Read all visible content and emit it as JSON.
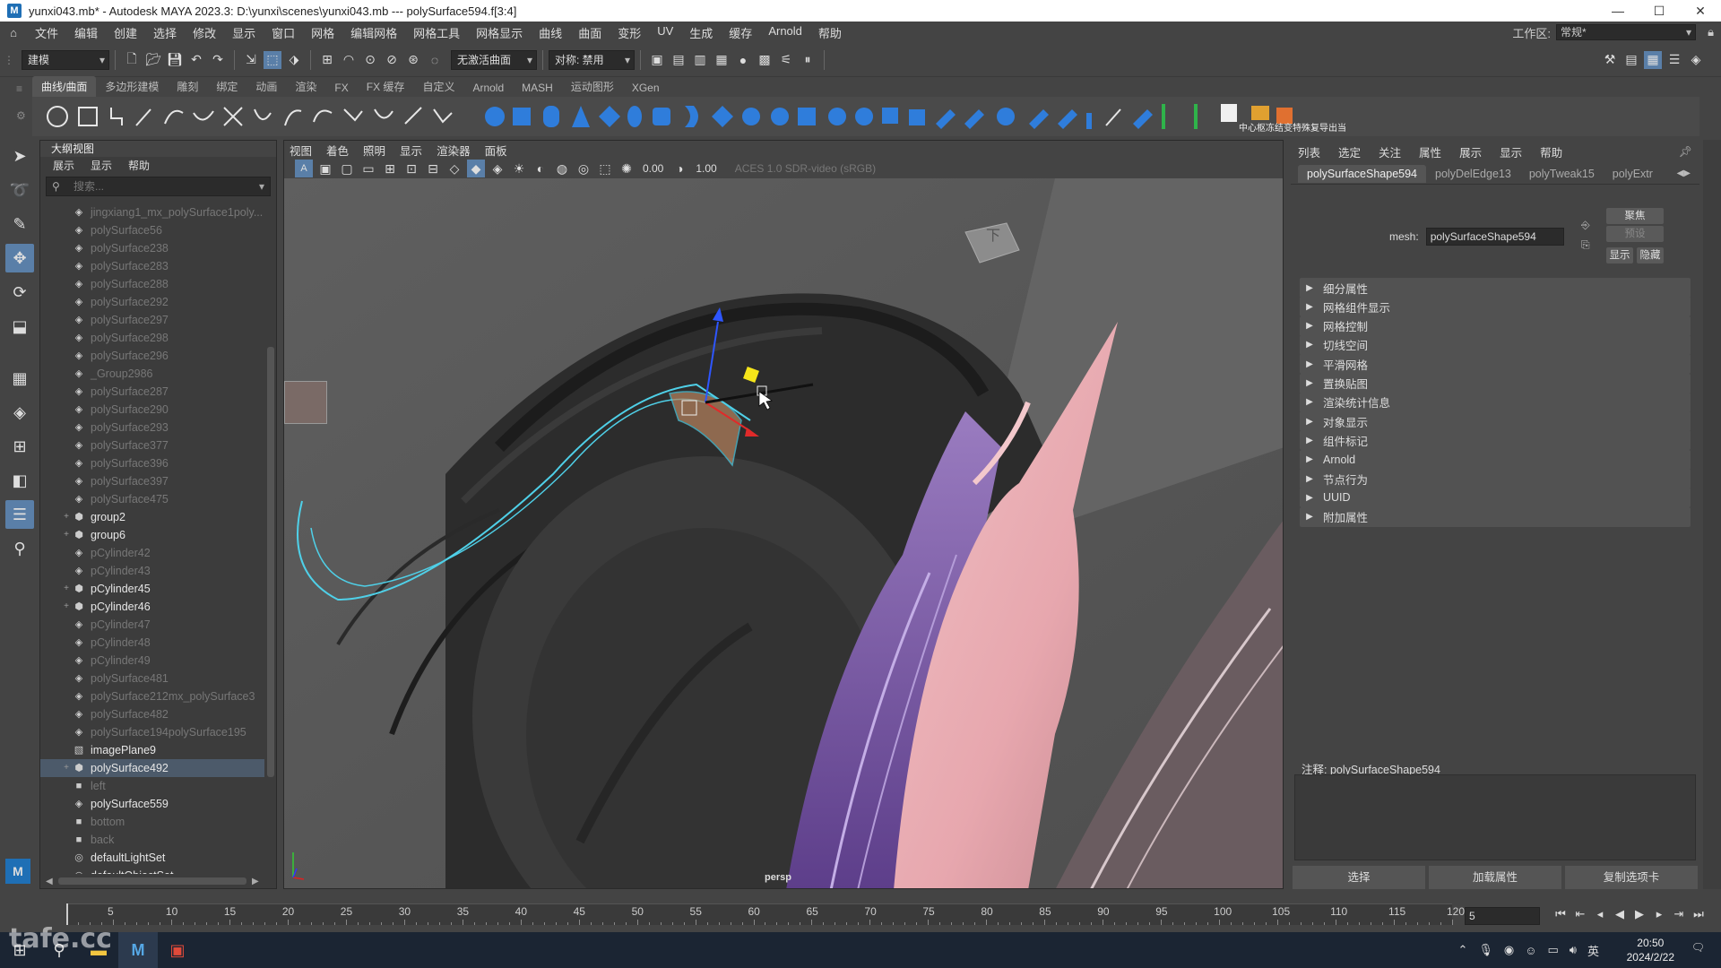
{
  "title_bar": {
    "app_icon": "M",
    "title": "yunxi043.mb* - Autodesk MAYA 2023.3: D:\\yunxi\\scenes\\yunxi043.mb   ---   polySurface594.f[3:4]",
    "controls": [
      "—",
      "☐",
      "✕"
    ]
  },
  "menu_bar": {
    "items": [
      "文件",
      "编辑",
      "创建",
      "选择",
      "修改",
      "显示",
      "窗口",
      "网格",
      "编辑网格",
      "网格工具",
      "网格显示",
      "曲线",
      "曲面",
      "变形",
      "UV",
      "生成",
      "缓存",
      "Arnold",
      "帮助"
    ],
    "workspace_label": "工作区:",
    "workspace_value": "常规*"
  },
  "status_line": {
    "mode": "建模",
    "live_surface": "无激活曲面",
    "symmetry": "对称: 禁用"
  },
  "shelf": {
    "tabs": [
      "曲线/曲面",
      "多边形建模",
      "雕刻",
      "绑定",
      "动画",
      "渲染",
      "FX",
      "FX 缓存",
      "自定义",
      "Arnold",
      "MASH",
      "运动图形",
      "XGen"
    ],
    "active_tab": "曲线/曲面",
    "text_buttons": [
      "中心枢",
      "冻结变",
      "特殊复",
      "导出当"
    ]
  },
  "outliner": {
    "title": "大纲视图",
    "menu": [
      "展示",
      "显示",
      "帮助"
    ],
    "search_placeholder": "搜索...",
    "rows": [
      {
        "name": "jingxiang1_mx_polySurface1poly...",
        "dim": true,
        "exp": "",
        "icon": "mesh"
      },
      {
        "name": "polySurface56",
        "dim": true,
        "exp": "",
        "icon": "mesh"
      },
      {
        "name": "polySurface238",
        "dim": true,
        "exp": "",
        "icon": "mesh"
      },
      {
        "name": "polySurface283",
        "dim": true,
        "exp": "",
        "icon": "mesh"
      },
      {
        "name": "polySurface288",
        "dim": true,
        "exp": "",
        "icon": "mesh"
      },
      {
        "name": "polySurface292",
        "dim": true,
        "exp": "",
        "icon": "mesh"
      },
      {
        "name": "polySurface297",
        "dim": true,
        "exp": "",
        "icon": "mesh"
      },
      {
        "name": "polySurface298",
        "dim": true,
        "exp": "",
        "icon": "mesh"
      },
      {
        "name": "polySurface296",
        "dim": true,
        "exp": "",
        "icon": "mesh"
      },
      {
        "name": "_Group2986",
        "dim": true,
        "exp": "",
        "icon": "mesh"
      },
      {
        "name": "polySurface287",
        "dim": true,
        "exp": "",
        "icon": "mesh"
      },
      {
        "name": "polySurface290",
        "dim": true,
        "exp": "",
        "icon": "mesh"
      },
      {
        "name": "polySurface293",
        "dim": true,
        "exp": "",
        "icon": "mesh"
      },
      {
        "name": "polySurface377",
        "dim": true,
        "exp": "",
        "icon": "mesh"
      },
      {
        "name": "polySurface396",
        "dim": true,
        "exp": "",
        "icon": "mesh"
      },
      {
        "name": "polySurface397",
        "dim": true,
        "exp": "",
        "icon": "mesh"
      },
      {
        "name": "polySurface475",
        "dim": true,
        "exp": "",
        "icon": "mesh"
      },
      {
        "name": "group2",
        "dim": false,
        "exp": "+",
        "icon": "group"
      },
      {
        "name": "group6",
        "dim": false,
        "exp": "+",
        "icon": "group"
      },
      {
        "name": "pCylinder42",
        "dim": true,
        "exp": "",
        "icon": "mesh"
      },
      {
        "name": "pCylinder43",
        "dim": true,
        "exp": "",
        "icon": "mesh"
      },
      {
        "name": "pCylinder45",
        "dim": false,
        "exp": "+",
        "icon": "group"
      },
      {
        "name": "pCylinder46",
        "dim": false,
        "exp": "+",
        "icon": "group"
      },
      {
        "name": "pCylinder47",
        "dim": true,
        "exp": "",
        "icon": "mesh"
      },
      {
        "name": "pCylinder48",
        "dim": true,
        "exp": "",
        "icon": "mesh"
      },
      {
        "name": "pCylinder49",
        "dim": true,
        "exp": "",
        "icon": "mesh"
      },
      {
        "name": "polySurface481",
        "dim": true,
        "exp": "",
        "icon": "mesh"
      },
      {
        "name": "polySurface212mx_polySurface3",
        "dim": true,
        "exp": "",
        "icon": "mesh"
      },
      {
        "name": "polySurface482",
        "dim": true,
        "exp": "",
        "icon": "mesh"
      },
      {
        "name": "polySurface194polySurface195",
        "dim": true,
        "exp": "",
        "icon": "mesh"
      },
      {
        "name": "imagePlane9",
        "dim": false,
        "exp": "",
        "icon": "image"
      },
      {
        "name": "polySurface492",
        "dim": false,
        "exp": "+",
        "icon": "group",
        "selected": true
      },
      {
        "name": "left",
        "dim": true,
        "exp": "",
        "icon": "camera"
      },
      {
        "name": "polySurface559",
        "dim": false,
        "exp": "",
        "icon": "mesh"
      },
      {
        "name": "bottom",
        "dim": true,
        "exp": "",
        "icon": "camera"
      },
      {
        "name": "back",
        "dim": true,
        "exp": "",
        "icon": "camera"
      },
      {
        "name": "defaultLightSet",
        "dim": false,
        "exp": "",
        "icon": "set"
      },
      {
        "name": "defaultObjectSet",
        "dim": false,
        "exp": "",
        "icon": "set"
      }
    ]
  },
  "viewport": {
    "menu": [
      "视图",
      "着色",
      "照明",
      "显示",
      "渲染器",
      "面板"
    ],
    "near_value": "0.00",
    "far_value": "1.00",
    "color_space": "ACES 1.0 SDR-video (sRGB)",
    "camera_label": "persp",
    "viewcube_face": "下"
  },
  "attribute_editor": {
    "menu": [
      "列表",
      "选定",
      "关注",
      "属性",
      "展示",
      "显示",
      "帮助"
    ],
    "tabs": [
      "polySurfaceShape594",
      "polyDelEdge13",
      "polyTweak15",
      "polyExtr"
    ],
    "active_tab": "polySurfaceShape594",
    "mesh_label": "mesh:",
    "mesh_value": "polySurfaceShape594",
    "buttons": {
      "focus": "聚焦",
      "preset": "预设",
      "show": "显示",
      "hide": "隐藏"
    },
    "sections": [
      "细分属性",
      "网格组件显示",
      "网格控制",
      "切线空间",
      "平滑网格",
      "置换贴图",
      "渲染统计信息",
      "对象显示",
      "组件标记",
      "Arnold",
      "节点行为",
      "UUID",
      "附加属性"
    ],
    "notes_label": "注释:  polySurfaceShape594",
    "bottom_buttons": [
      "选择",
      "加载属性",
      "复制选项卡"
    ]
  },
  "timeline": {
    "ticks": [
      5,
      10,
      15,
      20,
      25,
      30,
      35,
      40,
      45,
      50,
      55,
      60,
      65,
      70,
      75,
      80,
      85,
      90,
      95,
      100,
      105,
      110,
      115,
      120
    ],
    "range_start": 1,
    "range_end": 120,
    "current_frame": "5",
    "cursor_frame": 1
  },
  "taskbar": {
    "time": "20:50",
    "date": "2024/2/22",
    "ime": "英",
    "watermark": "tafe.cc"
  }
}
